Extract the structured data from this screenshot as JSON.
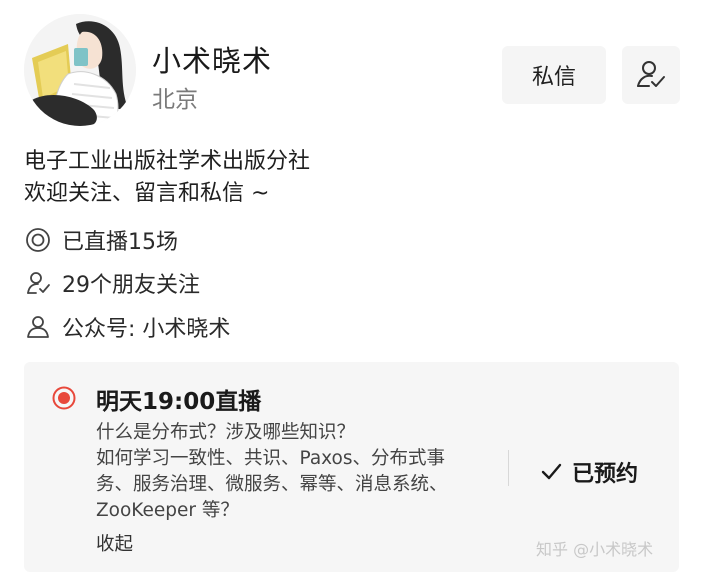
{
  "profile": {
    "name": "小术晓术",
    "location": "北京",
    "avatar_icon": "girl-reading-book-avatar"
  },
  "actions": {
    "message_label": "私信",
    "follow_icon": "user-check-icon"
  },
  "bio": {
    "line1": "电子工业出版社学术出版分社",
    "line2": "欢迎关注、留言和私信 ~"
  },
  "stats": [
    {
      "icon": "live-circle-icon",
      "text": "已直播15场"
    },
    {
      "icon": "friends-icon",
      "text": "29个朋友关注"
    },
    {
      "icon": "person-icon",
      "text": "公众号: 小术晓术"
    }
  ],
  "live_card": {
    "title": "明天19:00直播",
    "desc_line1": "什么是分布式？涉及哪些知识？",
    "desc_line2": "如何学习一致性、共识、Paxos、分布式事",
    "desc_line3": "务、服务治理、微服务、幂等、消息系统、",
    "desc_line4": "ZooKeeper 等？",
    "collapse_label": "收起",
    "booked_label": "已预约",
    "accent_color": "#e8483b"
  },
  "watermark": "知乎 @小术晓术"
}
